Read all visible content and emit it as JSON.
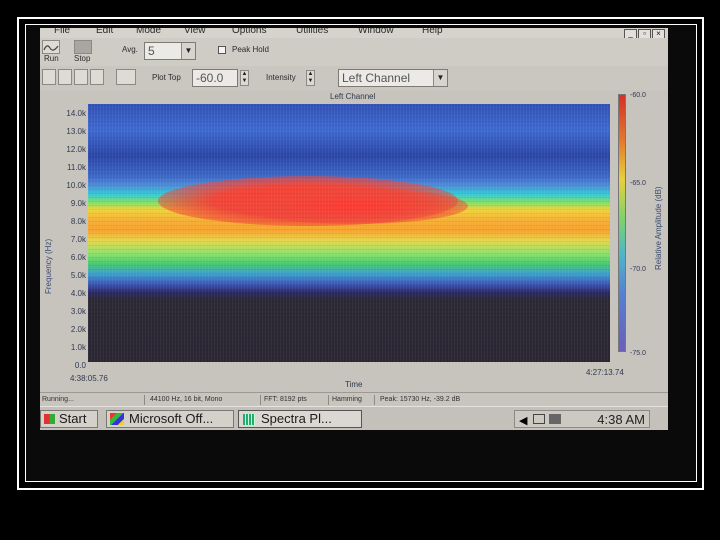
{
  "menubar": {
    "items": [
      "File",
      "Edit",
      "Mode",
      "View",
      "Options",
      "Utilities",
      "Window",
      "Help"
    ]
  },
  "toolbar": {
    "run_label": "Run",
    "stop_label": "Stop",
    "avg_label": "Avg.",
    "avg_value": "5",
    "peak_hold_label": "Peak Hold",
    "plot_top_label": "Plot Top",
    "plot_top_value": "-60.0",
    "intensity_label": "Intensity",
    "channel_value": "Left Channel"
  },
  "plot": {
    "title": "Left Channel",
    "y_label": "Frequency (Hz)",
    "y_ticks": [
      "14.0k",
      "13.0k",
      "12.0k",
      "11.0k",
      "10.0k",
      "9.0k",
      "8.0k",
      "7.0k",
      "6.0k",
      "5.0k",
      "4.0k",
      "3.0k",
      "2.0k",
      "1.0k",
      "0.0"
    ],
    "x_label": "Time",
    "x_start": "4:38:05.76",
    "x_end": "4:27:13.74",
    "colorbar_label": "Relative Amplitude (dB)",
    "colorbar_ticks": [
      "-60.0",
      "-65.0",
      "-70.0",
      "-75.0"
    ]
  },
  "status": {
    "state": "Running...",
    "format": "44100 Hz, 16 bit, Mono",
    "fft": "FFT: 8192 pts",
    "window": "Hamming",
    "peak": "Peak: 15730 Hz, -39.2 dB"
  },
  "taskbar": {
    "start_label": "Start",
    "task1_label": "Microsoft Off...",
    "task2_label": "Spectra Pl...",
    "clock": "4:38 AM"
  }
}
